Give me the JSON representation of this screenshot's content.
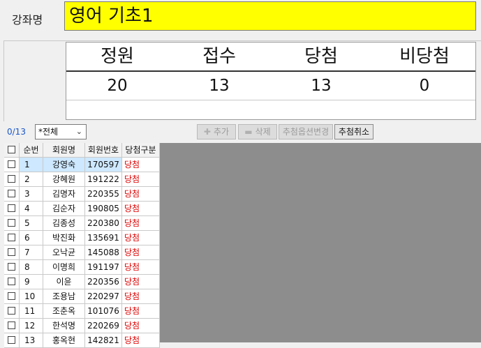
{
  "course": {
    "label": "강좌명",
    "value": "영어 기초1"
  },
  "stats": {
    "headers": [
      "정원",
      "접수",
      "당첨",
      "비당첨"
    ],
    "values": [
      "20",
      "13",
      "13",
      "0"
    ]
  },
  "toolbar": {
    "count": "0/13",
    "filter_value": "*전체",
    "add_label": "추가",
    "delete_label": "삭제",
    "change_option_label": "추첨옵션변경",
    "cancel_draw_label": "추첨취소"
  },
  "grid": {
    "headers": {
      "num": "순번",
      "name": "회원명",
      "id": "회원번호",
      "status": "당첨구분"
    },
    "rows": [
      {
        "num": "1",
        "name": "강영숙",
        "id": "170597",
        "status": "당첨"
      },
      {
        "num": "2",
        "name": "강혜원",
        "id": "191222",
        "status": "당첨"
      },
      {
        "num": "3",
        "name": "김명자",
        "id": "220355",
        "status": "당첨"
      },
      {
        "num": "4",
        "name": "김순자",
        "id": "190805",
        "status": "당첨"
      },
      {
        "num": "5",
        "name": "김종성",
        "id": "220380",
        "status": "당첨"
      },
      {
        "num": "6",
        "name": "박진화",
        "id": "135691",
        "status": "당첨"
      },
      {
        "num": "7",
        "name": "오낙균",
        "id": "145088",
        "status": "당첨"
      },
      {
        "num": "8",
        "name": "이명희",
        "id": "191197",
        "status": "당첨"
      },
      {
        "num": "9",
        "name": "이윤",
        "id": "220356",
        "status": "당첨"
      },
      {
        "num": "10",
        "name": "조용남",
        "id": "220297",
        "status": "당첨"
      },
      {
        "num": "11",
        "name": "조춘옥",
        "id": "101076",
        "status": "당첨"
      },
      {
        "num": "12",
        "name": "한석명",
        "id": "220269",
        "status": "당첨"
      },
      {
        "num": "13",
        "name": "홍옥현",
        "id": "142821",
        "status": "당첨"
      }
    ]
  },
  "colors": {
    "course_field_bg": "#ffff00",
    "win_status": "#e00000",
    "selected_row": "#cde8ff",
    "count_label": "#1a56c8"
  },
  "icons": {
    "add": "plus-icon",
    "delete": "minus-icon",
    "dropdown": "chevron-down-icon"
  }
}
